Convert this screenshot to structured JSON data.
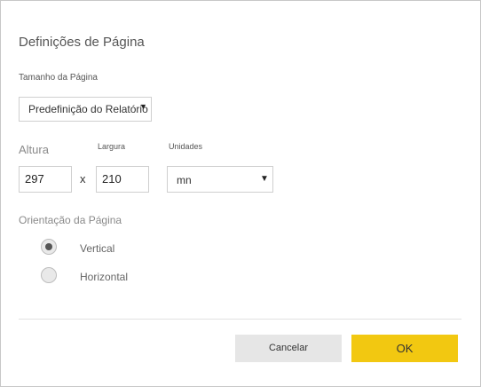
{
  "dialog": {
    "title": "Definições de Página"
  },
  "page_size": {
    "label": "Tamanho da Página",
    "selected": "Predefinição do Relatório",
    "caret": "▼"
  },
  "dimensions": {
    "height_label": "Altura",
    "height_value": "297",
    "separator": "x",
    "width_label": "Largura",
    "width_value": "210",
    "units_label": "Unidades",
    "units_selected": "mn",
    "units_caret": "▼"
  },
  "orientation": {
    "label": "Orientação da Página",
    "options": [
      {
        "label": "Vertical",
        "selected": true
      },
      {
        "label": "Horizontal",
        "selected": false
      }
    ]
  },
  "buttons": {
    "cancel": "Cancelar",
    "ok": "OK"
  },
  "colors": {
    "ok_button": "#f2c811",
    "cancel_button": "#e6e6e6",
    "border": "#cfcfcf"
  }
}
